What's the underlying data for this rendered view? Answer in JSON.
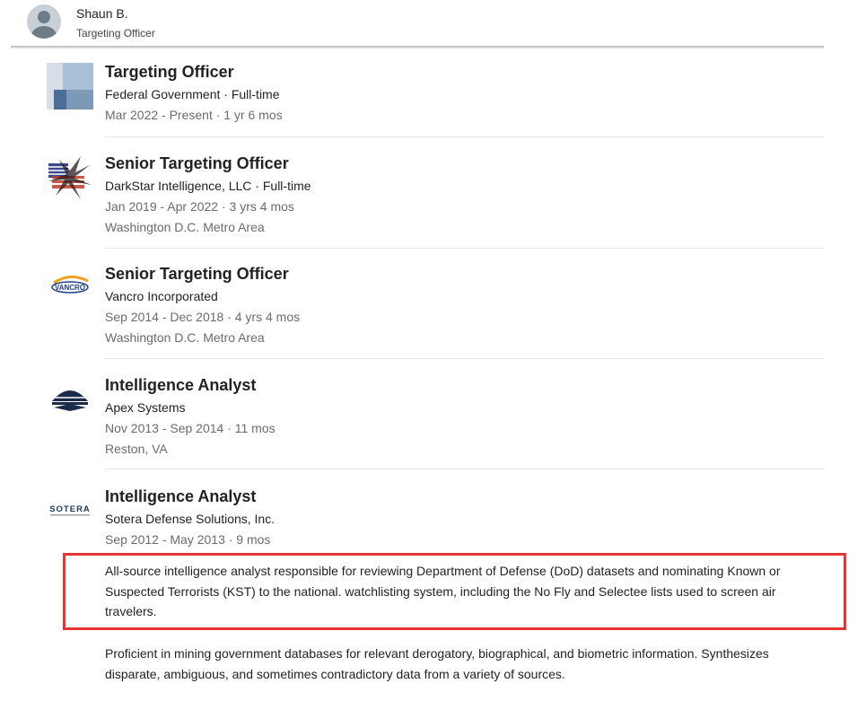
{
  "profile": {
    "name": "Shaun B.",
    "headline": "Targeting Officer"
  },
  "experience": [
    {
      "role": "Targeting Officer",
      "company": "Federal Government · Full-time",
      "dates": "Mar 2022 - Present · 1 yr 6 mos",
      "location": "",
      "logo": "generic-building-icon"
    },
    {
      "role": "Senior Targeting Officer",
      "company": "DarkStar Intelligence, LLC · Full-time",
      "dates": "Jan 2019 - Apr 2022 · 3 yrs 4 mos",
      "location": "Washington D.C. Metro Area",
      "logo": "darkstar-logo"
    },
    {
      "role": "Senior Targeting Officer",
      "company": "Vancro Incorporated",
      "dates": "Sep 2014 - Dec 2018 · 4 yrs 4 mos",
      "location": "Washington D.C. Metro Area",
      "logo": "vancro-logo",
      "logo_text": "VANCRO"
    },
    {
      "role": "Intelligence Analyst",
      "company": "Apex Systems",
      "dates": "Nov 2013 - Sep 2014 · 11 mos",
      "location": "Reston, VA",
      "logo": "apex-logo"
    },
    {
      "role": "Intelligence Analyst",
      "company": "Sotera Defense Solutions, Inc.",
      "dates": "Sep 2012 - May 2013 · 9 mos",
      "location": "",
      "logo": "sotera-logo",
      "logo_text": "SOTERA",
      "description": [
        "All-source intelligence analyst responsible for reviewing Department of Defense (DoD) datasets and nominating Known or Suspected Terrorists (KST) to the national. watchlisting system, including the No Fly and Selectee lists used to screen air travelers.",
        "Proficient in mining government databases for relevant derogatory, biographical, and biometric information. Synthesizes disparate, ambiguous, and sometimes contradictory data from a variety of sources."
      ]
    }
  ],
  "colors": {
    "highlight_box": "#e53535",
    "muted_text": "#6b6b6b",
    "divider": "#e4e4e4"
  }
}
